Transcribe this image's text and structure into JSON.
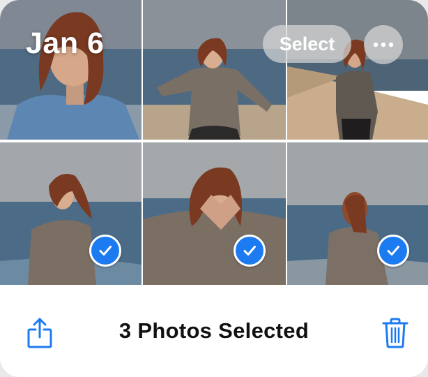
{
  "header": {
    "date_title": "Jan 6",
    "select_label": "Select",
    "more_icon": "ellipsis-icon"
  },
  "photos": [
    {
      "label": "photo-1",
      "selected": false
    },
    {
      "label": "photo-2",
      "selected": false
    },
    {
      "label": "photo-3",
      "selected": false
    },
    {
      "label": "photo-4",
      "selected": true
    },
    {
      "label": "photo-5",
      "selected": true
    },
    {
      "label": "photo-6",
      "selected": true
    }
  ],
  "toolbar": {
    "status": "3 Photos Selected",
    "share_icon": "share-icon",
    "trash_icon": "trash-icon"
  },
  "colors": {
    "accent": "#1d7bf2",
    "check_border": "#ffffff",
    "overlay_button": "#d7d7d7"
  }
}
